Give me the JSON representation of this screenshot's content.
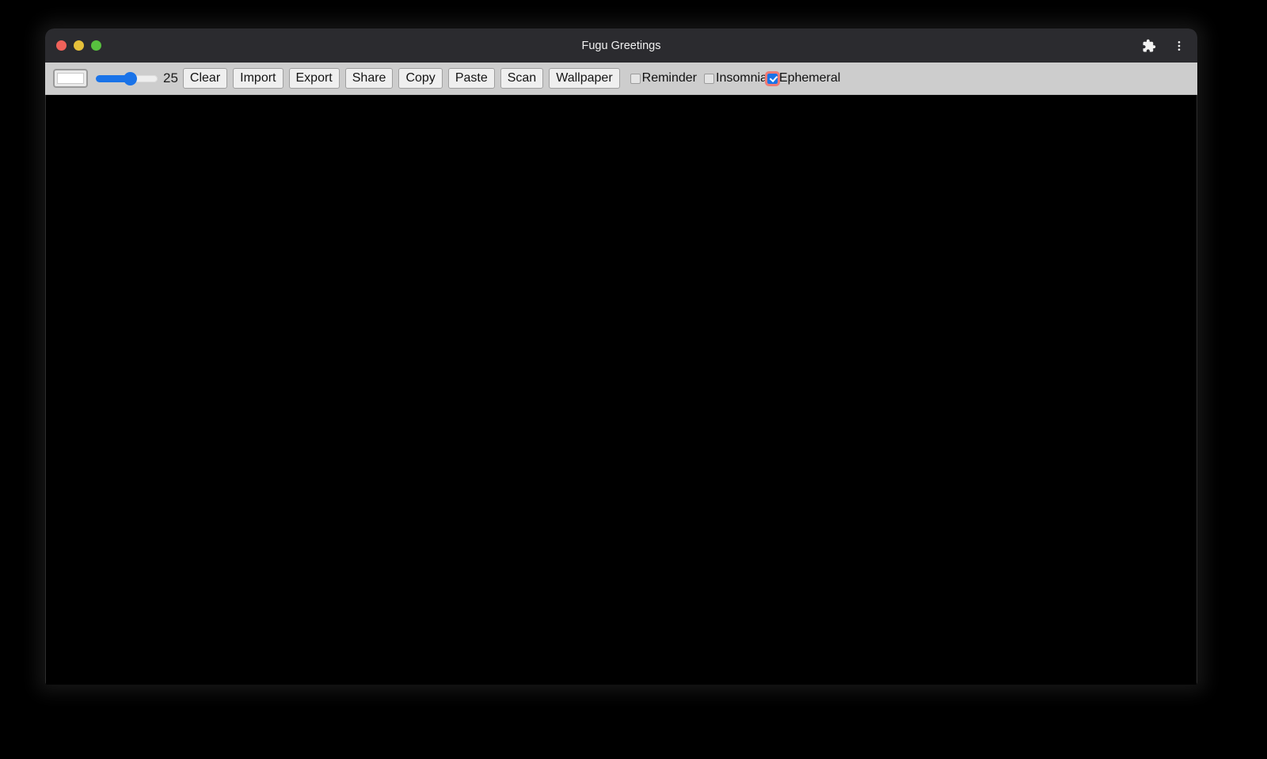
{
  "window": {
    "title": "Fugu Greetings",
    "traffic_lights": [
      {
        "name": "close",
        "color": "#f0625a"
      },
      {
        "name": "minimize",
        "color": "#e6c03a"
      },
      {
        "name": "maximize",
        "color": "#58c03f"
      }
    ],
    "right_icons": [
      {
        "name": "extensions-icon"
      },
      {
        "name": "more-menu-icon"
      }
    ]
  },
  "toolbar": {
    "color_picker": {
      "label": "color-picker",
      "value": "#ffffff"
    },
    "slider": {
      "label": "line-width-slider",
      "value": 25,
      "min": 0,
      "max": 50,
      "percent": 55
    },
    "slider_value_text": "25",
    "buttons": [
      {
        "name": "clear-button",
        "label": "Clear"
      },
      {
        "name": "import-button",
        "label": "Import"
      },
      {
        "name": "export-button",
        "label": "Export"
      },
      {
        "name": "share-button",
        "label": "Share"
      },
      {
        "name": "copy-button",
        "label": "Copy"
      },
      {
        "name": "paste-button",
        "label": "Paste"
      },
      {
        "name": "scan-button",
        "label": "Scan"
      },
      {
        "name": "wallpaper-button",
        "label": "Wallpaper"
      }
    ],
    "checkboxes": [
      {
        "name": "reminder-checkbox",
        "label": "Reminder",
        "checked": false
      },
      {
        "name": "insomnia-checkbox",
        "label": "Insomnia",
        "checked": false
      },
      {
        "name": "ephemeral-checkbox",
        "label": "Ephemeral",
        "checked": true,
        "focused": true
      }
    ]
  },
  "canvas": {
    "name": "drawing-canvas",
    "background": "#000000"
  },
  "colors": {
    "accent": "#1a73e8",
    "toolbar_bg": "#cdcdcd",
    "titlebar_bg": "#2b2b2f",
    "focus_ring": "#ef7a74",
    "page_bg": "#000000"
  }
}
